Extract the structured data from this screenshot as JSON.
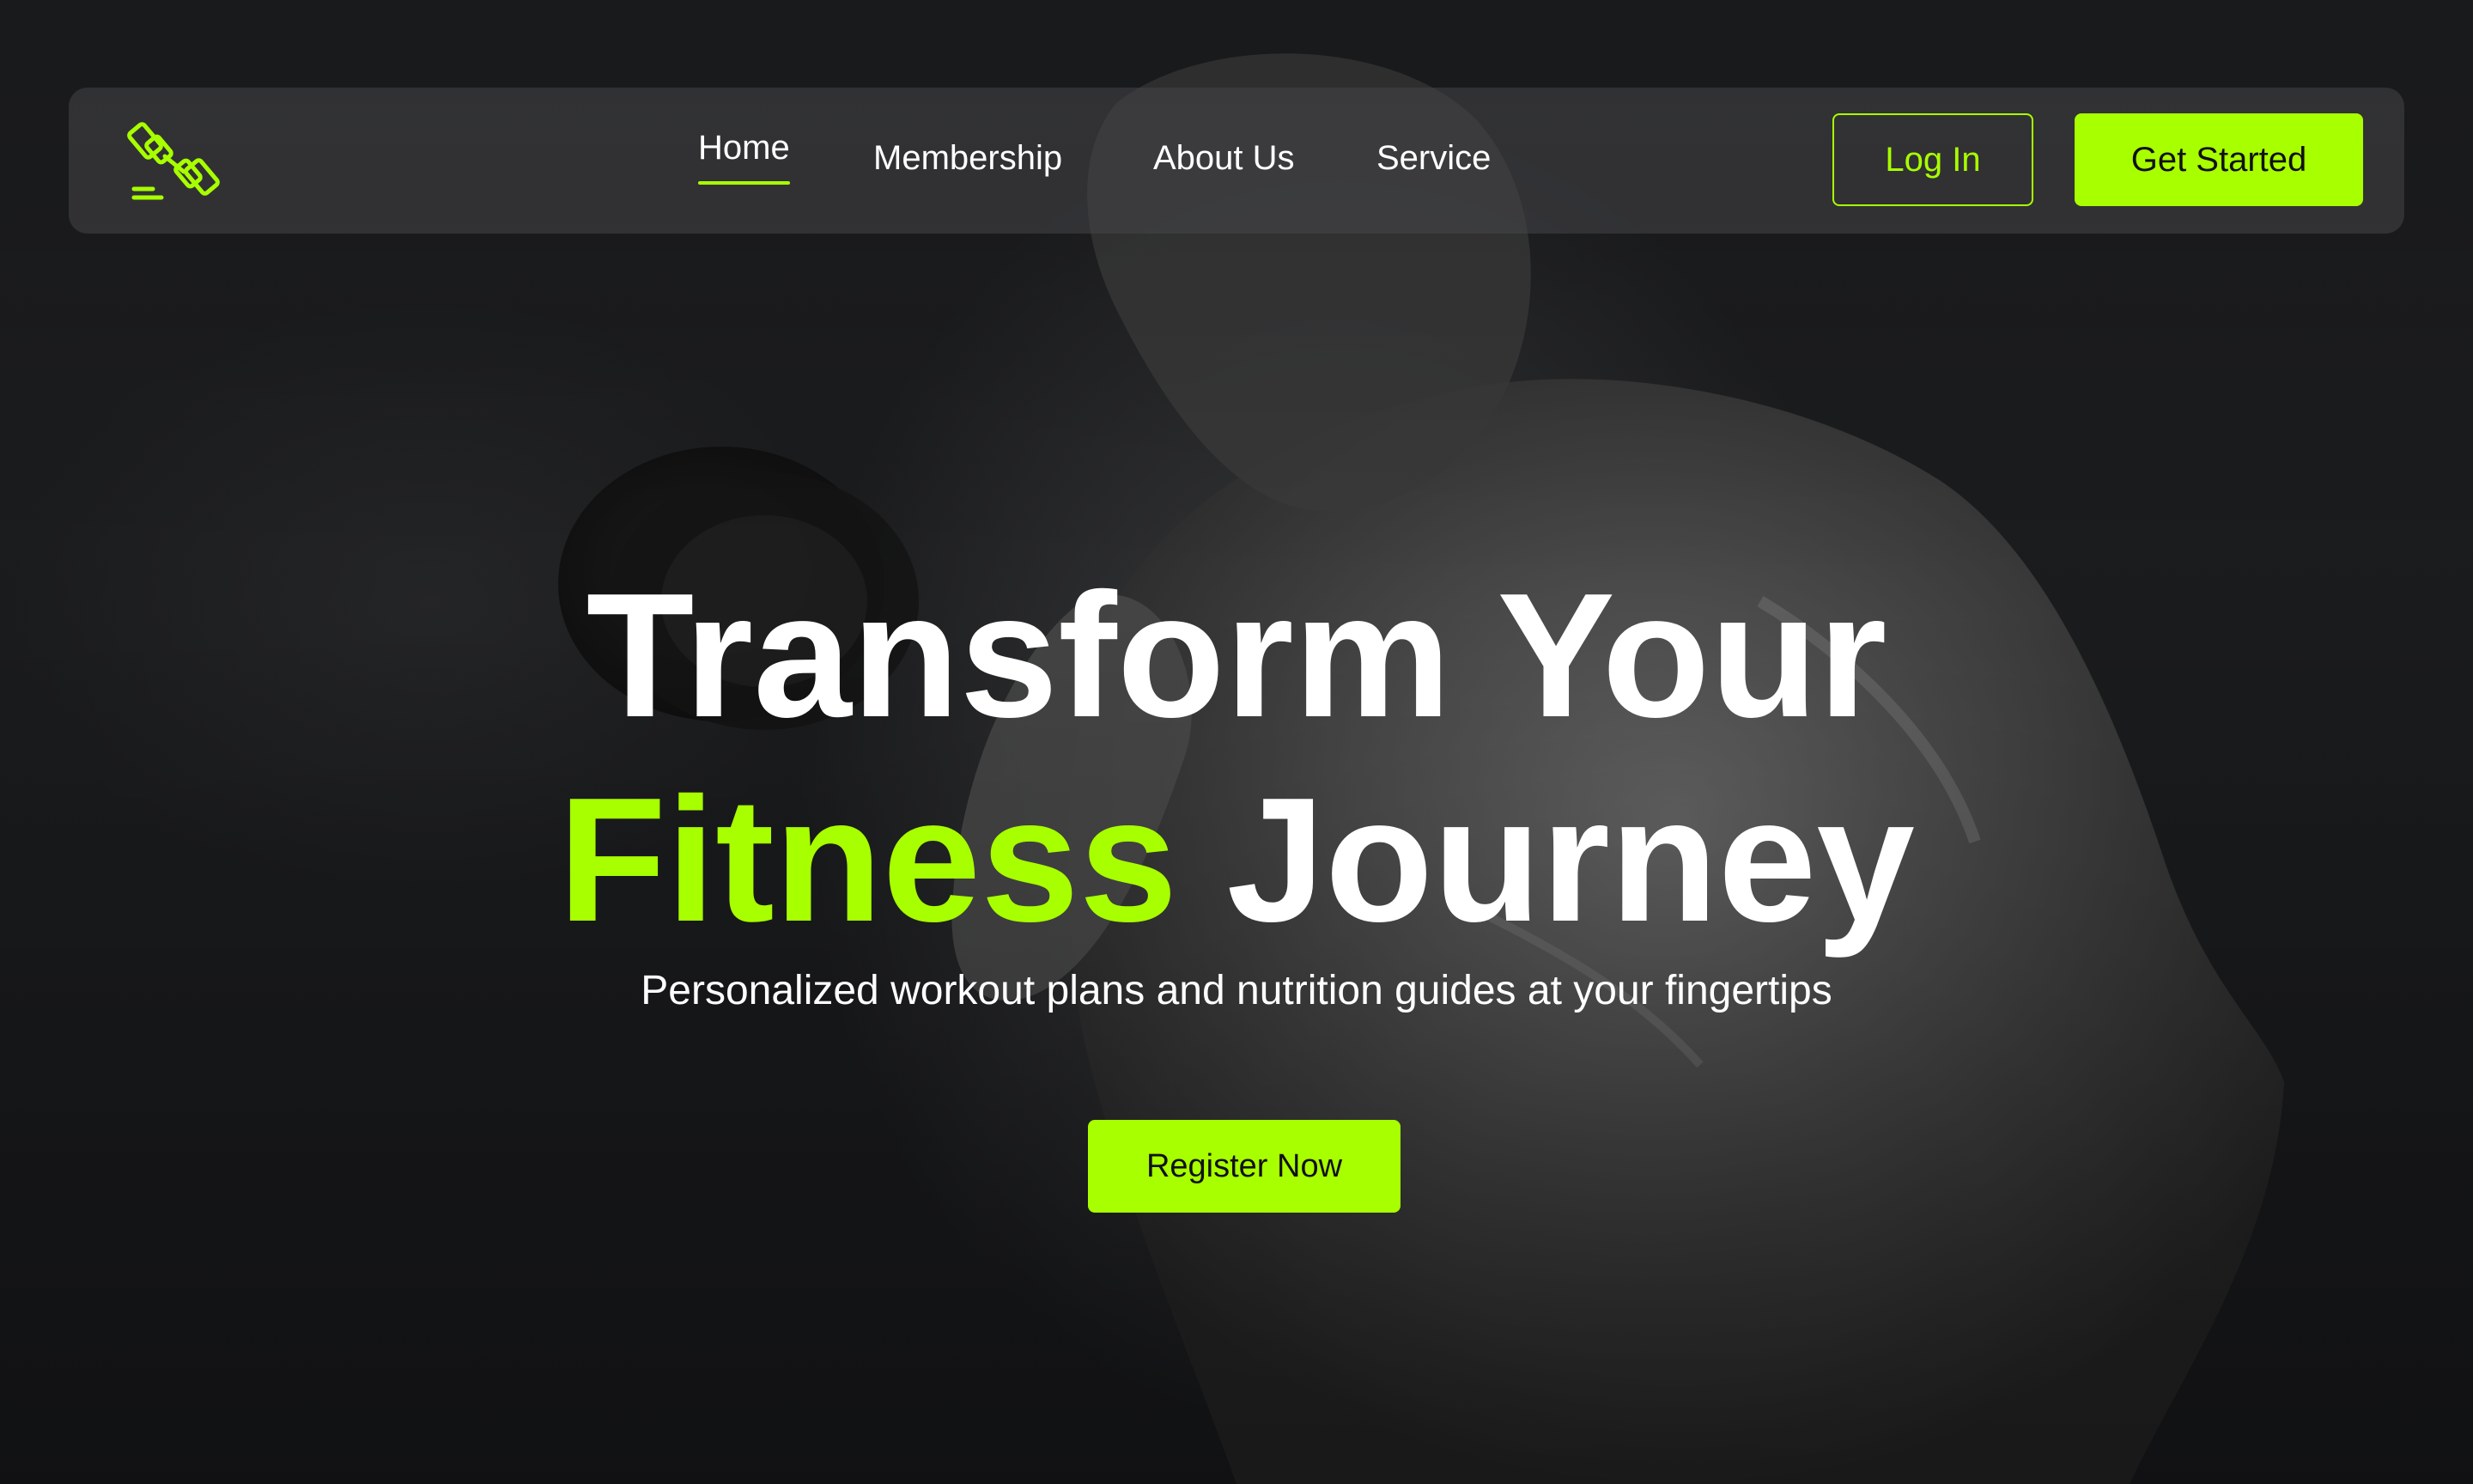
{
  "nav": {
    "logo_icon": "dumbbell-icon",
    "links": [
      "Home",
      "Membership",
      "About Us",
      "Service"
    ],
    "active": "Home",
    "login_label": "Log In",
    "get_started_label": "Get Started"
  },
  "hero": {
    "line1": "Transform Your",
    "line2_accent": "Fitness",
    "line2_rest": "Journey",
    "subtitle": "Personalized workout plans and nutrition guides at your fingertips",
    "cta_label": "Register Now"
  },
  "colors": {
    "accent": "#a8ff00",
    "background": "#1a1b1d",
    "text": "#ffffff",
    "button_text": "#111111"
  }
}
